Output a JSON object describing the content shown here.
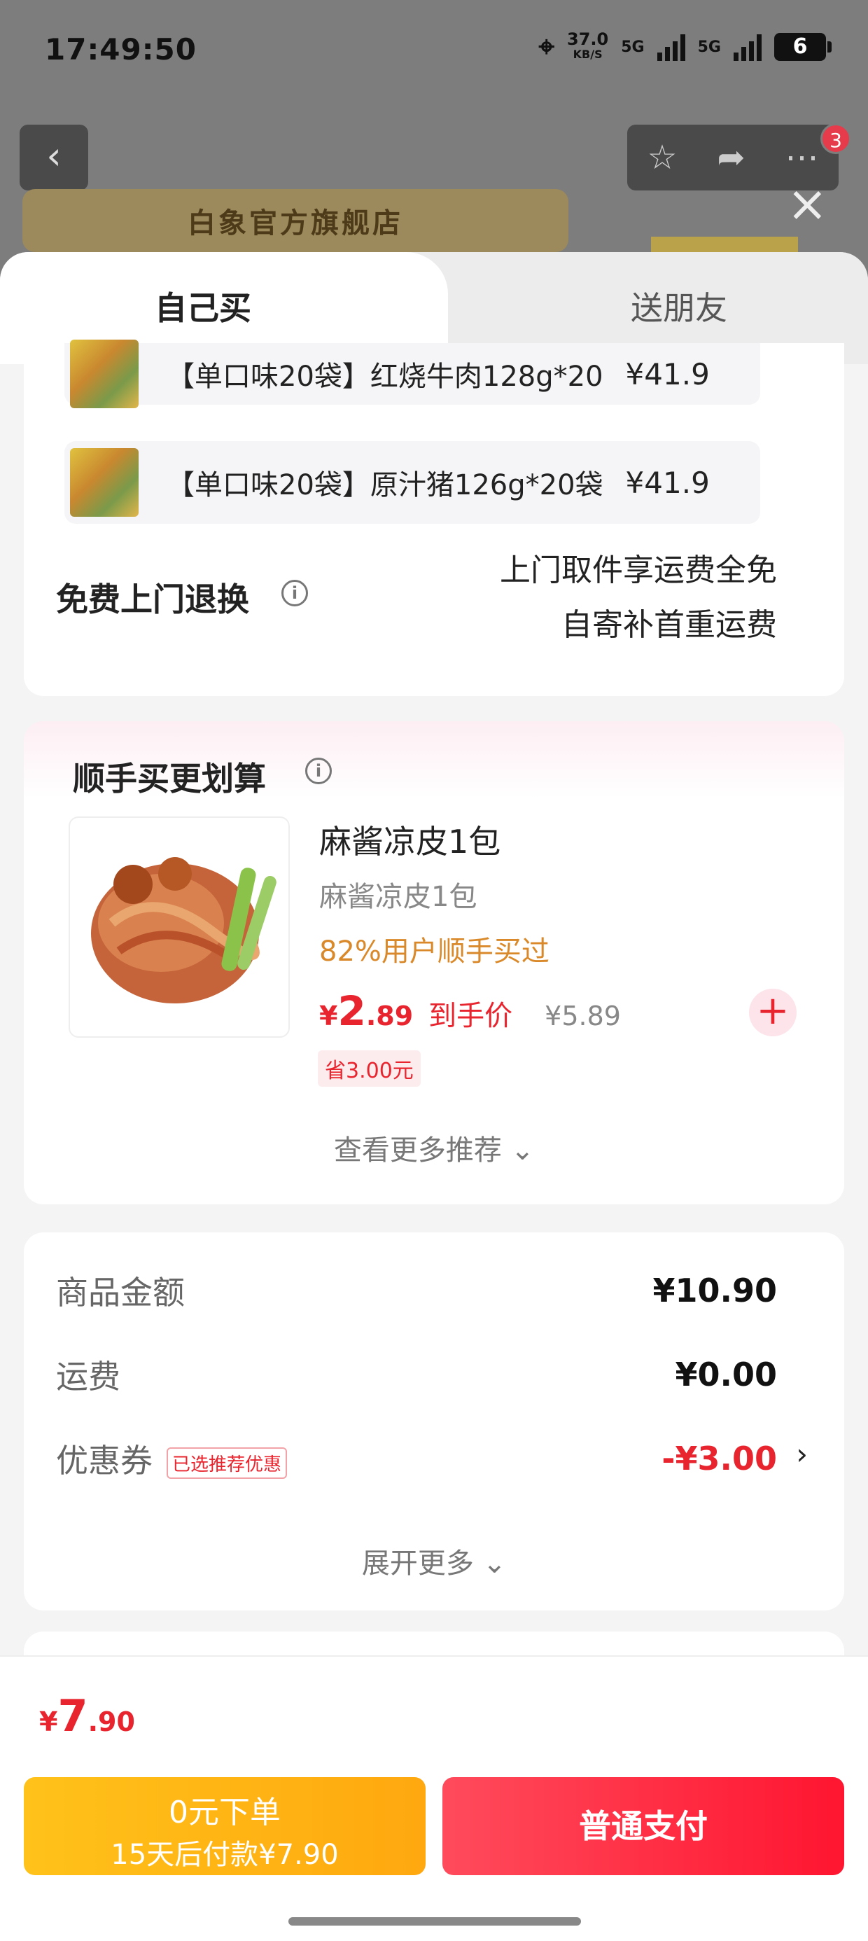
{
  "status_bar": {
    "time": "17:49:50",
    "net_speed": "37.0",
    "net_unit": "KB/S",
    "signal1": "5G",
    "signal2": "5G",
    "battery": "6"
  },
  "header": {
    "back_icon": "chevron-left-icon",
    "shop_name": "白象官方旗舰店",
    "cart_badge": "3",
    "close_icon": "close-icon"
  },
  "tabs": {
    "self": "自己买",
    "friend": "送朋友"
  },
  "variants": [
    {
      "label": "【单口味20袋】红烧牛肉128g*20",
      "price": "¥41.9"
    },
    {
      "label": "【单口味20袋】原汁猪126g*20袋",
      "price": "¥41.9"
    }
  ],
  "returns": {
    "title": "免费上门退换",
    "info_icon": "i",
    "line1": "上门取件享运费全免",
    "line2": "自寄补首重运费"
  },
  "recommend": {
    "title": "顺手买更划算",
    "info_icon": "i",
    "product": {
      "name": "麻酱凉皮1包",
      "sub": "麻酱凉皮1包",
      "tag": "82%用户顺手买过",
      "currency": "¥",
      "price_int": "2",
      "price_dec": ".89",
      "price_label": "到手价",
      "original_price": "¥5.89",
      "save": "省3.00元",
      "add": "+"
    },
    "more": "查看更多推荐 ⌄"
  },
  "summary": {
    "goods_label": "商品金额",
    "goods_value": "¥10.90",
    "shipping_label": "运费",
    "shipping_value": "¥0.00",
    "coupon_label": "优惠券",
    "coupon_tag": "已选推荐优惠",
    "coupon_value": "-¥3.00",
    "coupon_chevron": "›",
    "expand": "展开更多 ⌄"
  },
  "footer": {
    "currency": "¥",
    "total_int": "7",
    "total_dec": ".90",
    "zero_line1": "0元下单",
    "zero_line2": "15天后付款¥7.90",
    "pay": "普通支付"
  },
  "colors": {
    "accent_red": "#e8252e",
    "pay_yellow": "#ffb414",
    "tag_orange": "#d9892a"
  }
}
